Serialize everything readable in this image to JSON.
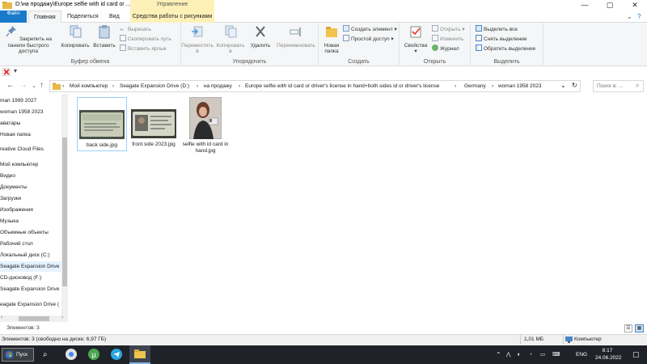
{
  "window": {
    "title": "D:\\на продажу\\Europe selfie with id card or ...",
    "context_tab": "Управление",
    "controls": {
      "minimize": "—",
      "maximize": "▢",
      "close": "✕"
    }
  },
  "tabs": [
    {
      "label": "Файл"
    },
    {
      "label": "Главная"
    },
    {
      "label": "Поделиться"
    },
    {
      "label": "Вид"
    },
    {
      "label": "Средства работы с рисунками"
    }
  ],
  "ribbon": {
    "clipboard": {
      "pin_label": "Закрепить на панели быстрого доступа",
      "copy_label": "Копировать",
      "paste_label": "Вставить",
      "cut_label": "Вырезать",
      "copy_path_label": "Скопировать путь",
      "paste_shortcut_label": "Вставить ярлык",
      "group_label": "Буфер обмена"
    },
    "organize": {
      "move_label": "Переместить в",
      "copy_to_label": "Копировать в",
      "delete_label": "Удалить",
      "rename_label": "Переименовать",
      "group_label": "Упорядочить"
    },
    "create": {
      "new_folder_label": "Новая папка",
      "new_item_label": "Создать элемент",
      "easy_access_label": "Простой доступ",
      "group_label": "Создать"
    },
    "open": {
      "properties_label": "Свойства",
      "open_label": "Открыть",
      "edit_label": "Изменить",
      "history_label": "Журнал",
      "group_label": "Открыть"
    },
    "select": {
      "select_all_label": "Выделить все",
      "select_none_label": "Снять выделение",
      "invert_label": "Обратить выделение",
      "group_label": "Выделить"
    }
  },
  "address": {
    "crumbs": [
      "Мой компьютер",
      "Seagate Expansion Drive (D:)",
      "на продажу",
      "Europe selfie with id card or driver's license in hand+both sides id or driver's license",
      "Germany",
      "woman 1958 2023"
    ],
    "search_placeholder": "Поиск в: ..."
  },
  "nav_items": [
    {
      "label": "man 1999 2027"
    },
    {
      "label": "woman 1958 2023"
    },
    {
      "label": "аватары"
    },
    {
      "label": "Новая папка"
    },
    {
      "label": "reative Cloud Files"
    },
    {
      "label": "Мой компьютер"
    },
    {
      "label": "Видео"
    },
    {
      "label": "Документы"
    },
    {
      "label": "Загрузки"
    },
    {
      "label": "Изображения"
    },
    {
      "label": "Музыка"
    },
    {
      "label": "Объемные объекты"
    },
    {
      "label": "Рабочий стол"
    },
    {
      "label": "Локальный диск (C:)"
    },
    {
      "label": "Seagate Expansion Drive"
    },
    {
      "label": "CD-дисковод (F:)"
    },
    {
      "label": "Seagate Expansion Drive"
    },
    {
      "label": "eagate Expansion Drive ("
    }
  ],
  "files": [
    {
      "name": "back side.jpg"
    },
    {
      "name": "front side 2023.jpg"
    },
    {
      "name": "selfie with id card in hand.jpg"
    }
  ],
  "status": {
    "items_count": "Элементов: 3",
    "summary": "Элементов: 3 (свободно на диске: 6,97 ГБ)",
    "size": "1,01 МБ",
    "location": "Компьютер"
  },
  "taskbar": {
    "start_label": "Пуск",
    "lang": "ENG",
    "time": "8:17",
    "date": "24.06.2022"
  },
  "colors": {
    "accent": "#1979ca",
    "context_tab": "#fdf1b8",
    "taskbar": "#1f2329",
    "selection": "#e5f3ff"
  }
}
